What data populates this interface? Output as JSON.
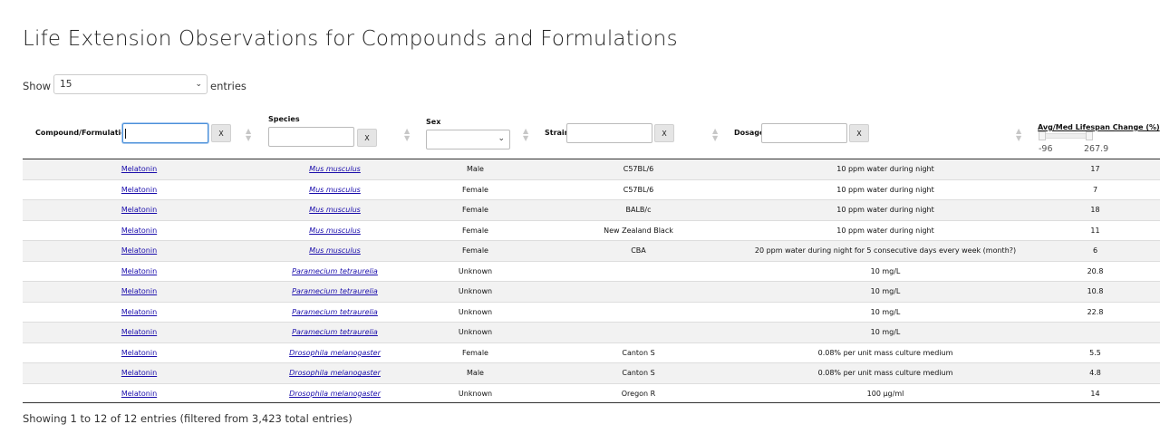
{
  "page_title": "Life Extension Observations for Compounds and Formulations",
  "length_menu": {
    "show_label": "Show",
    "selected": "15",
    "entries_label": "entries"
  },
  "columns": {
    "compound": "Compound/Formulation",
    "species": "Species",
    "sex": "Sex",
    "strain": "Strain",
    "dosage": "Dosage",
    "lifespan": "Avg/Med Lifespan Change (%)"
  },
  "clear_label": "X",
  "lifespan_range": {
    "min": "-96",
    "max": "267.9"
  },
  "rows": [
    {
      "compound": "Melatonin",
      "species": "Mus musculus",
      "sex": "Male",
      "strain": "C57BL/6",
      "dosage": "10 ppm water during night",
      "lifespan": "17"
    },
    {
      "compound": "Melatonin",
      "species": "Mus musculus",
      "sex": "Female",
      "strain": "C57BL/6",
      "dosage": "10 ppm water during night",
      "lifespan": "7"
    },
    {
      "compound": "Melatonin",
      "species": "Mus musculus",
      "sex": "Female",
      "strain": "BALB/c",
      "dosage": "10 ppm water during night",
      "lifespan": "18"
    },
    {
      "compound": "Melatonin",
      "species": "Mus musculus",
      "sex": "Female",
      "strain": "New Zealand Black",
      "dosage": "10 ppm water during night",
      "lifespan": "11"
    },
    {
      "compound": "Melatonin",
      "species": "Mus musculus",
      "sex": "Female",
      "strain": "CBA",
      "dosage": "20 ppm water during night for 5 consecutive days every week (month?)",
      "lifespan": "6"
    },
    {
      "compound": "Melatonin",
      "species": "Paramecium tetraurelia",
      "sex": "Unknown",
      "strain": "",
      "dosage": "10 mg/L",
      "lifespan": "20.8"
    },
    {
      "compound": "Melatonin",
      "species": "Paramecium tetraurelia",
      "sex": "Unknown",
      "strain": "",
      "dosage": "10 mg/L",
      "lifespan": "10.8"
    },
    {
      "compound": "Melatonin",
      "species": "Paramecium tetraurelia",
      "sex": "Unknown",
      "strain": "",
      "dosage": "10 mg/L",
      "lifespan": "22.8"
    },
    {
      "compound": "Melatonin",
      "species": "Paramecium tetraurelia",
      "sex": "Unknown",
      "strain": "",
      "dosage": "10 mg/L",
      "lifespan": ""
    },
    {
      "compound": "Melatonin",
      "species": "Drosophila melanogaster",
      "sex": "Female",
      "strain": "Canton S",
      "dosage": "0.08% per unit mass culture medium",
      "lifespan": "5.5"
    },
    {
      "compound": "Melatonin",
      "species": "Drosophila melanogaster",
      "sex": "Male",
      "strain": "Canton S",
      "dosage": "0.08% per unit mass culture medium",
      "lifespan": "4.8"
    },
    {
      "compound": "Melatonin",
      "species": "Drosophila melanogaster",
      "sex": "Unknown",
      "strain": "Oregon R",
      "dosage": "100 µg/ml",
      "lifespan": "14"
    }
  ],
  "table_info": "Showing 1 to 12 of 12 entries (filtered from 3,423 total entries)"
}
